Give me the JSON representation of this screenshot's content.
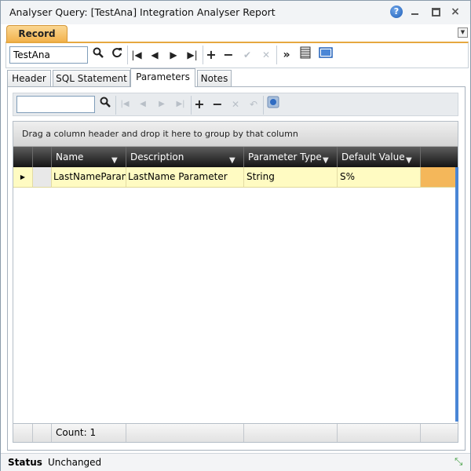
{
  "window": {
    "title": "Analyser Query: [TestAna] Integration Analyser Report",
    "help_glyph": "?",
    "close_glyph": "×"
  },
  "ribbon": {
    "active_tab": "Record",
    "record_value": "TestAna",
    "icons": [
      "search-icon",
      "refresh-icon",
      "first-record-icon",
      "previous-record-icon",
      "next-record-icon",
      "last-record-icon",
      "add-icon",
      "remove-icon",
      "accept-icon",
      "cancel-icon",
      "more-icon",
      "columns-icon",
      "layout-icon"
    ]
  },
  "tabs": [
    "Header",
    "SQL Statement",
    "Parameters",
    "Notes"
  ],
  "active_tab": "Parameters",
  "grid": {
    "group_hint": "Drag a column header and drop it here to group by that column",
    "columns": [
      "Name",
      "Description",
      "Parameter Type",
      "Default Value"
    ],
    "rows": [
      {
        "name": "LastNameParam",
        "description": "LastName Parameter",
        "type": "String",
        "default": "S%"
      }
    ],
    "count_label": "Count: 1"
  },
  "status": {
    "label": "Status",
    "value": "Unchanged"
  },
  "colors": {
    "accent": "#f2b14a",
    "selected_row": "#fffbc2",
    "header_bg": "#141414",
    "status_value_color": "#1f5fb8"
  }
}
